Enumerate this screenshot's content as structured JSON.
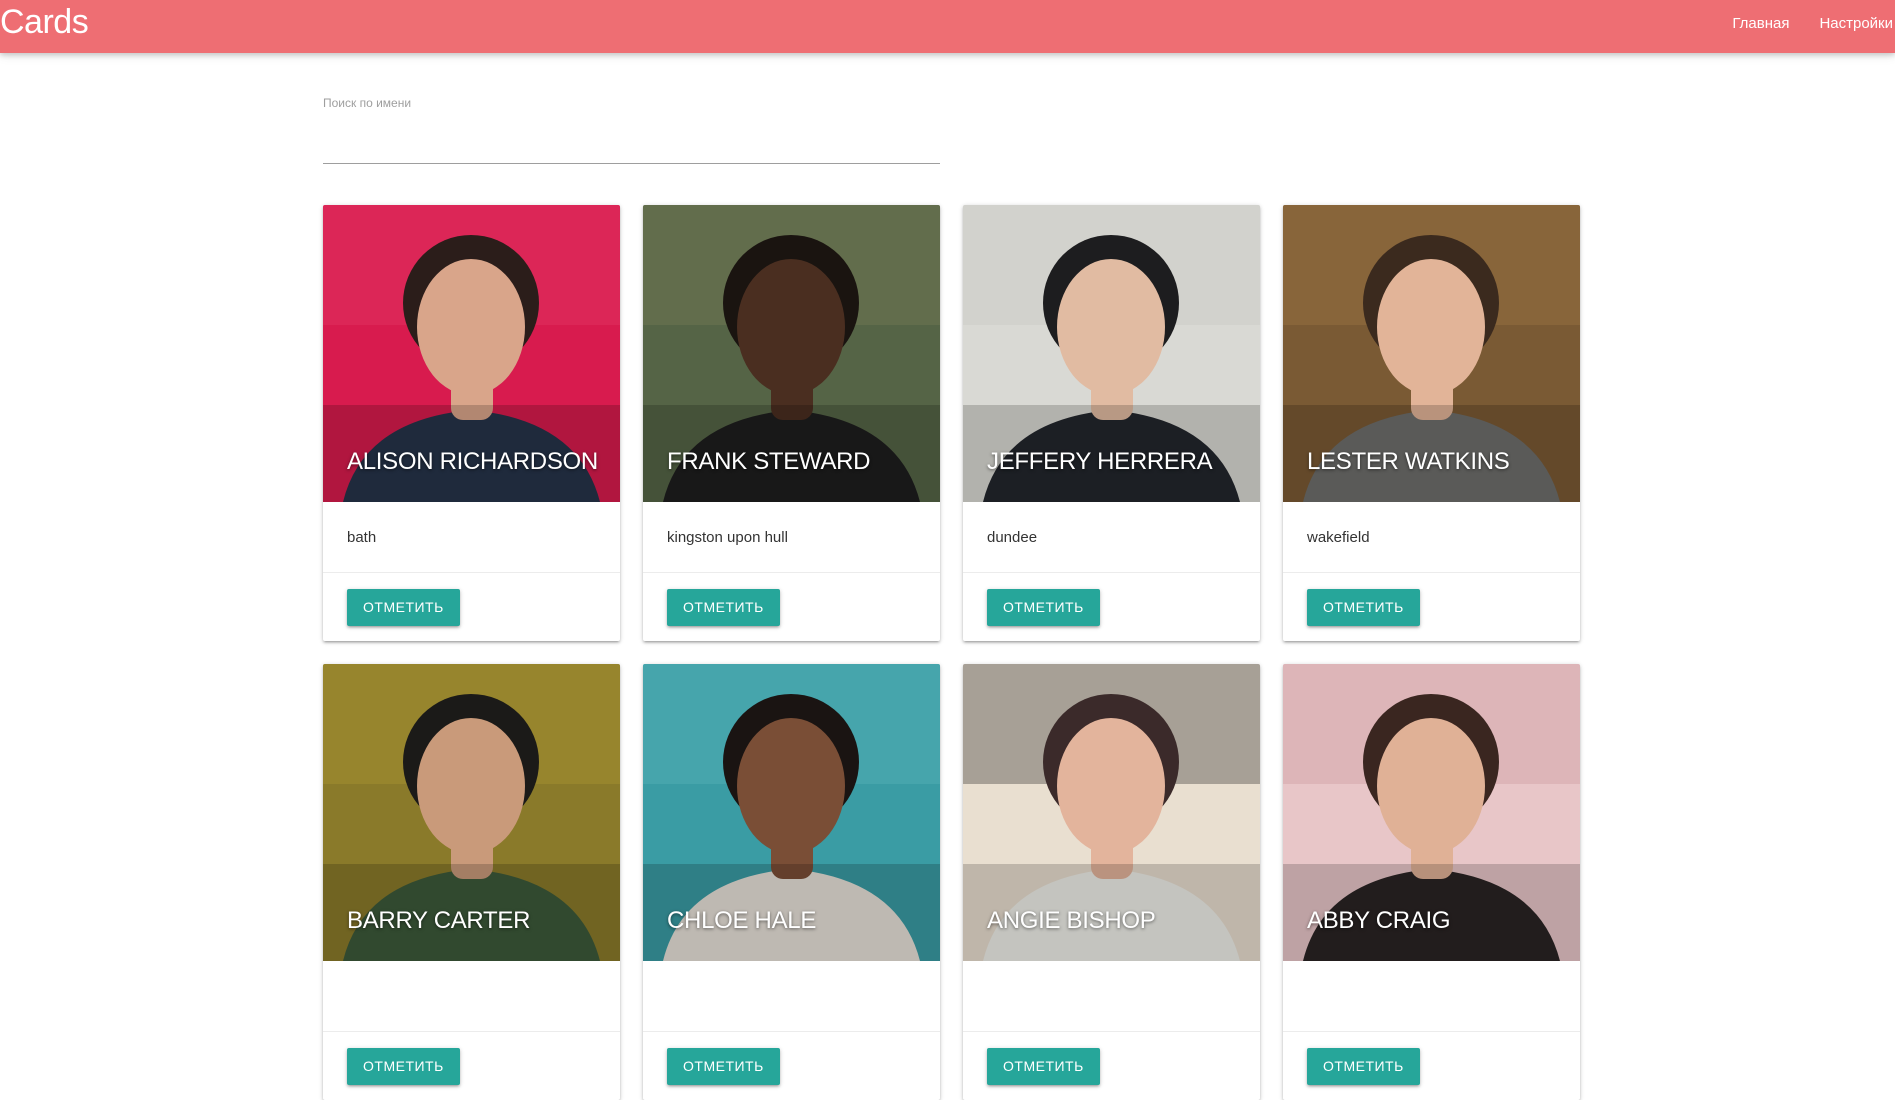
{
  "navbar": {
    "brand": "Cards",
    "links": [
      "Главная",
      "Настройки"
    ],
    "color": "#ee6e73"
  },
  "search": {
    "label": "Поиск по имени",
    "value": ""
  },
  "cards": [
    {
      "name": "ALISON RICHARDSON",
      "city": "bath",
      "button": "ОТМЕТИТЬ",
      "photo_colors": [
        "#d81b4e",
        "#e43d6a",
        "#2b1d1a",
        "#d9a58a",
        "#27344a"
      ]
    },
    {
      "name": "FRANK STEWARD",
      "city": "kingston upon hull",
      "button": "ОТМЕТИТЬ",
      "photo_colors": [
        "#556446",
        "#7a7f5a",
        "#1a1410",
        "#4a2e20",
        "#1e1e1e"
      ]
    },
    {
      "name": "JEFFERY HERRERA",
      "city": "dundee",
      "button": "ОТМЕТИТЬ",
      "photo_colors": [
        "#d9d9d4",
        "#c5c6c0",
        "#1d1d1f",
        "#e1bba2",
        "#23262c"
      ]
    },
    {
      "name": "LESTER WATKINS",
      "city": "wakefield",
      "button": "ОТМЕТИТЬ",
      "photo_colors": [
        "#7a5a34",
        "#a27b48",
        "#3b2a1e",
        "#e2b498",
        "#6e6e6c"
      ]
    },
    {
      "name": "BARRY CARTER",
      "city": "",
      "button": "ОТМЕТИТЬ",
      "photo_colors": [
        "#8a7a2a",
        "#b09a34",
        "#1b1a18",
        "#c99a7a",
        "#3c5a3a"
      ]
    },
    {
      "name": "CHLOE HALE",
      "city": "",
      "button": "ОТМЕТИТЬ",
      "photo_colors": [
        "#3a9ca4",
        "#5fb7bd",
        "#1a1412",
        "#7a4e36",
        "#e8e2da"
      ]
    },
    {
      "name": "ANGIE BISHOP",
      "city": "",
      "button": "ОТМЕТИТЬ",
      "photo_colors": [
        "#e9dfd0",
        "#2f2a2c",
        "#3b2a2a",
        "#e3b49c",
        "#f0efe9"
      ]
    },
    {
      "name": "ABBY CRAIG",
      "city": "",
      "button": "ОТМЕТИТЬ",
      "photo_colors": [
        "#e8c6c8",
        "#c9949a",
        "#3a2620",
        "#e0b196",
        "#2a2424"
      ]
    }
  ]
}
